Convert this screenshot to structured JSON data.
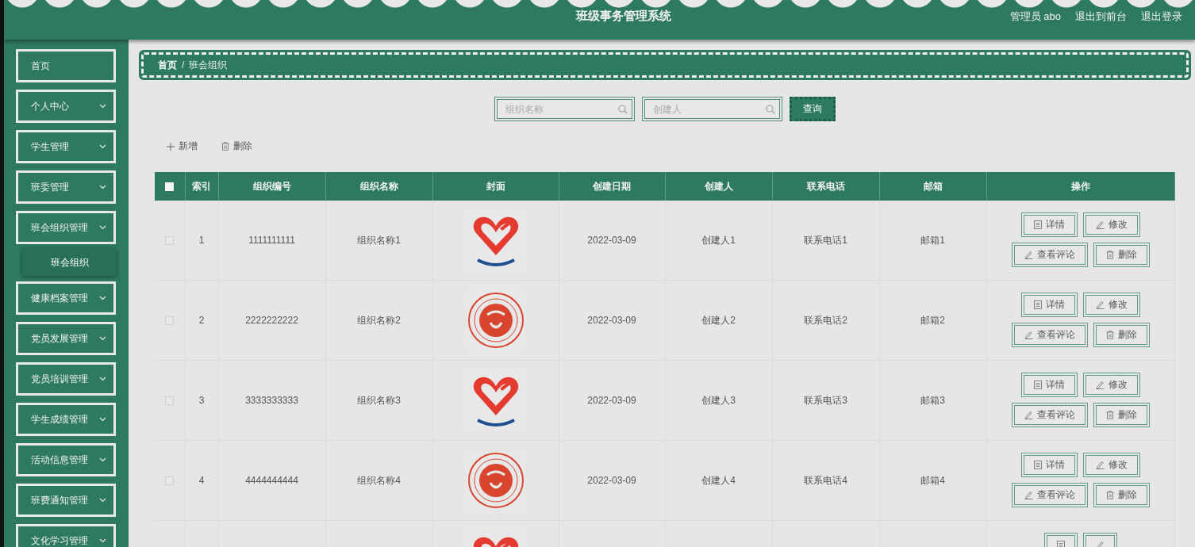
{
  "header": {
    "title": "班级事务管理系统",
    "links": [
      {
        "label": "管理员 abo"
      },
      {
        "label": "退出到前台"
      },
      {
        "label": "退出登录"
      }
    ]
  },
  "sidebar": {
    "items": [
      {
        "label": "首页",
        "kind": "link"
      },
      {
        "label": "个人中心",
        "kind": "menu"
      },
      {
        "label": "学生管理",
        "kind": "menu"
      },
      {
        "label": "班委管理",
        "kind": "menu"
      },
      {
        "label": "班会组织管理",
        "kind": "menu",
        "children": [
          {
            "label": "班会组织",
            "selected": true
          }
        ]
      },
      {
        "label": "健康档案管理",
        "kind": "menu"
      },
      {
        "label": "党员发展管理",
        "kind": "menu"
      },
      {
        "label": "党员培训管理",
        "kind": "menu"
      },
      {
        "label": "学生成绩管理",
        "kind": "menu"
      },
      {
        "label": "活动信息管理",
        "kind": "menu"
      },
      {
        "label": "班费通知管理",
        "kind": "menu"
      },
      {
        "label": "文化学习管理",
        "kind": "menu"
      }
    ]
  },
  "breadcrumb": [
    "首页",
    "/",
    "班会组织"
  ],
  "search": {
    "fields": [
      {
        "placeholder": "组织名称"
      },
      {
        "placeholder": "创建人"
      }
    ],
    "button": "查询"
  },
  "toolbar": [
    {
      "label": "新增",
      "kind": "add"
    },
    {
      "label": "删除",
      "kind": "delete"
    }
  ],
  "table": {
    "select_all": {
      "checked": false
    },
    "columns": [
      "索引",
      "组织编号",
      "组织名称",
      "封面",
      "创建日期",
      "创建人",
      "联系电话",
      "邮箱",
      "操作"
    ],
    "rows": [
      {
        "checked": false,
        "index": "1",
        "code": "1111111111",
        "name": "组织名称1",
        "cover": {
          "kind": "picture"
        },
        "date": "2022-03-09",
        "creator": "创建人1",
        "phone": "联系电话1",
        "email": "邮箱1",
        "actions": [
          {
            "label": "详情",
            "kind": "detail"
          },
          {
            "label": "修改",
            "kind": "edit"
          },
          {
            "label": "查看评论",
            "kind": "edit"
          },
          {
            "label": "删除",
            "kind": "delete"
          }
        ]
      },
      {
        "checked": false,
        "index": "2",
        "code": "2222222222",
        "name": "组织名称2",
        "cover": {
          "kind": "picture"
        },
        "date": "2022-03-09",
        "creator": "创建人2",
        "phone": "联系电话2",
        "email": "邮箱2",
        "actions": [
          {
            "label": "详情",
            "kind": "detail"
          },
          {
            "label": "修改",
            "kind": "edit"
          },
          {
            "label": "查看评论",
            "kind": "edit"
          },
          {
            "label": "删除",
            "kind": "delete"
          }
        ]
      },
      {
        "checked": false,
        "index": "3",
        "code": "3333333333",
        "name": "组织名称3",
        "cover": {
          "kind": "picture"
        },
        "date": "2022-03-09",
        "creator": "创建人3",
        "phone": "联系电话3",
        "email": "邮箱3",
        "actions": [
          {
            "label": "详情",
            "kind": "detail"
          },
          {
            "label": "修改",
            "kind": "edit"
          },
          {
            "label": "查看评论",
            "kind": "edit"
          },
          {
            "label": "删除",
            "kind": "delete"
          }
        ]
      },
      {
        "checked": false,
        "index": "4",
        "code": "4444444444",
        "name": "组织名称4",
        "cover": {
          "kind": "picture"
        },
        "date": "2022-03-09",
        "creator": "创建人4",
        "phone": "联系电话4",
        "email": "邮箱4",
        "actions": [
          {
            "label": "详情",
            "kind": "detail"
          },
          {
            "label": "修改",
            "kind": "edit"
          },
          {
            "label": "查看评论",
            "kind": "edit"
          },
          {
            "label": "删除",
            "kind": "delete"
          }
        ]
      },
      {
        "cover": {
          "kind": "picture"
        },
        "actions": [
          {
            "kind": "detail"
          },
          {
            "kind": "edit"
          }
        ]
      }
    ]
  }
}
